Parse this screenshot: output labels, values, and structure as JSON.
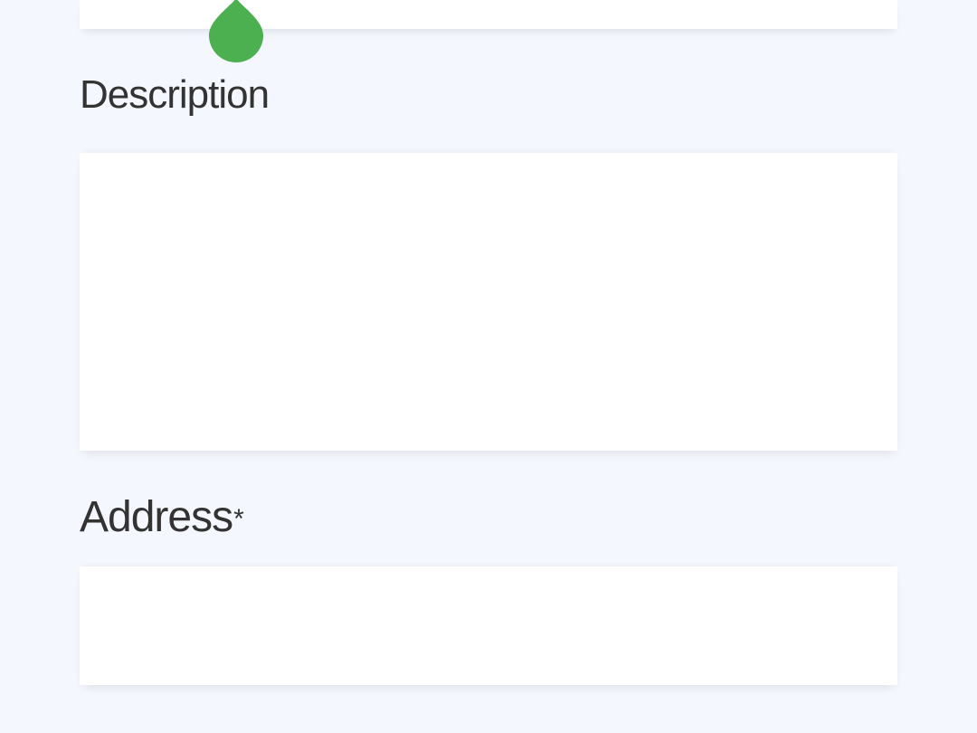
{
  "form": {
    "top_field": {
      "value": ""
    },
    "description": {
      "label": "Description",
      "value": ""
    },
    "address": {
      "label": "Address",
      "required_marker": "*",
      "value": ""
    }
  },
  "marker": {
    "icon": "water-drop-icon",
    "color": "#4caf50"
  },
  "colors": {
    "background": "#f4f7fd",
    "field_background": "#ffffff",
    "label_text": "#333333"
  }
}
